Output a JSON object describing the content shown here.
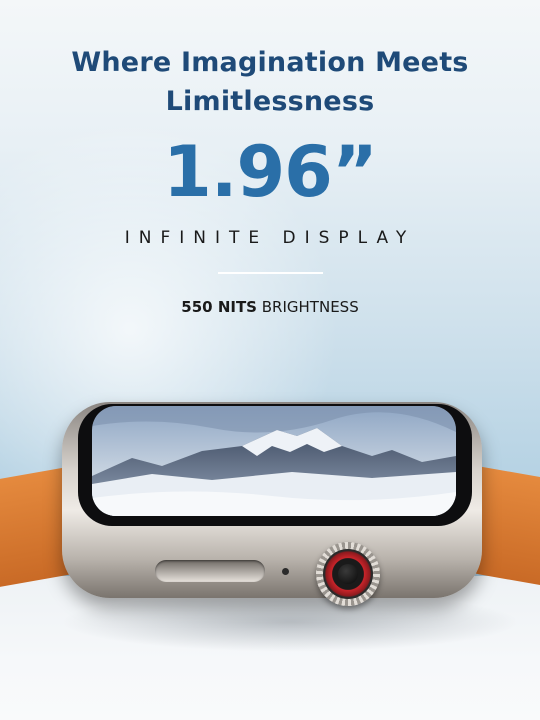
{
  "headline": {
    "line1": "Where Imagination Meets",
    "line2": "Limitlessness"
  },
  "display_size": "1.96”",
  "subtitle": "INFINITE DISPLAY",
  "brightness": {
    "value": "550 NITS",
    "label": "BRIGHTNESS"
  },
  "colors": {
    "headline": "#1f4a78",
    "size_accent": "#2a6fa8",
    "strap": "#e58a3e",
    "crown_accent": "#c8242a"
  },
  "image": {
    "subject": "smartwatch",
    "screen_content": "snowy-mountain-landscape"
  }
}
